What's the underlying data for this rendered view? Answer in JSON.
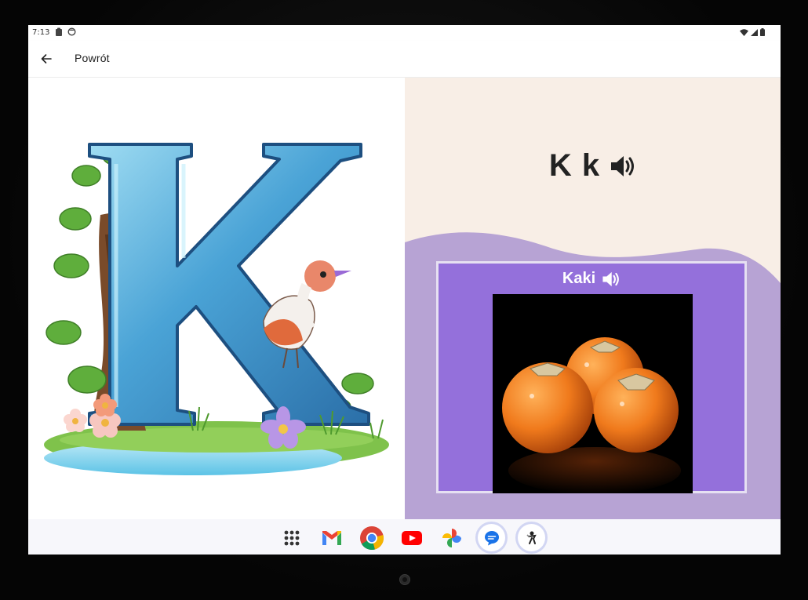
{
  "status_bar": {
    "time": "7:13",
    "left_icons": [
      "clipboard-icon",
      "face-icon"
    ],
    "right_icons": [
      "wifi-icon",
      "signal-icon",
      "battery-icon"
    ]
  },
  "app_bar": {
    "back_icon": "arrow-back-icon",
    "title": "Powrót"
  },
  "lesson": {
    "letter": "K k",
    "letter_sound_icon": "speaker-icon",
    "word": "Kaki",
    "word_sound_icon": "speaker-icon"
  },
  "colors": {
    "right_pane_bg": "#f8eee6",
    "wave": "#b7a3d4",
    "card": "#9470db",
    "card_border": "#e6e0f2"
  },
  "taskbar": {
    "apps": [
      "app-drawer-icon",
      "gmail-icon",
      "chrome-icon",
      "youtube-icon",
      "photos-icon",
      "messages-icon",
      "kids-app-icon"
    ]
  }
}
